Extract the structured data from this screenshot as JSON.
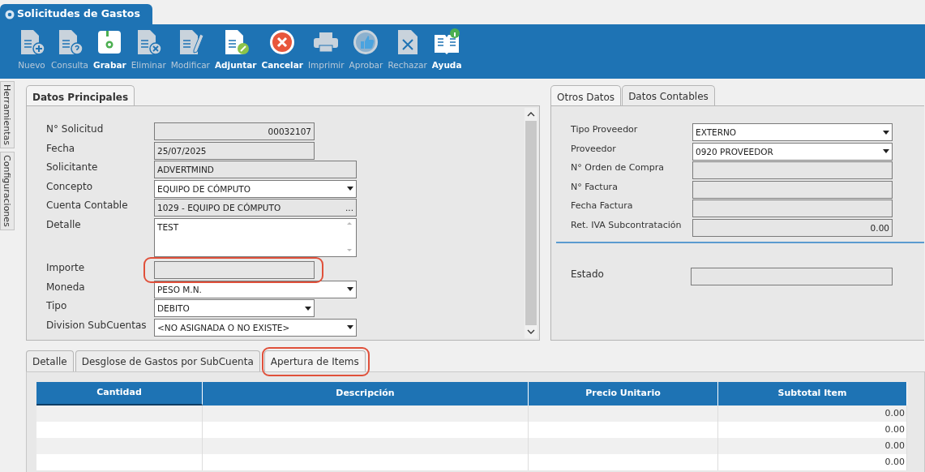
{
  "window": {
    "title": "Solicitudes de Gastos"
  },
  "toolbar": [
    {
      "label": "Nuevo",
      "disabled": true
    },
    {
      "label": "Consulta",
      "disabled": true
    },
    {
      "label": "Grabar",
      "disabled": false
    },
    {
      "label": "Eliminar",
      "disabled": true
    },
    {
      "label": "Modificar",
      "disabled": true
    },
    {
      "label": "Adjuntar",
      "disabled": false
    },
    {
      "label": "Cancelar",
      "disabled": false
    },
    {
      "label": "Imprimir",
      "disabled": true
    },
    {
      "label": "Aprobar",
      "disabled": true
    },
    {
      "label": "Rechazar",
      "disabled": true
    },
    {
      "label": "Ayuda",
      "disabled": false
    }
  ],
  "side_tabs": [
    {
      "label": "Herramientas"
    },
    {
      "label": "Configuraciones"
    }
  ],
  "main_panel": {
    "tabs": [
      {
        "label": "Datos Principales",
        "selected": true
      }
    ],
    "fields": [
      {
        "label": "N° Solicitud",
        "kind": "number",
        "value": "00032107",
        "readonly": true,
        "highlighted": false
      },
      {
        "label": "Fecha",
        "kind": "text",
        "value": "25/07/2025",
        "readonly": true,
        "highlighted": false
      },
      {
        "label": "Solicitante",
        "kind": "text",
        "value": "ADVERTMIND",
        "readonly": true,
        "highlighted": false
      },
      {
        "label": "Concepto",
        "kind": "combo",
        "value": "EQUIPO DE CÓMPUTO",
        "readonly": false,
        "highlighted": false
      },
      {
        "label": "Cuenta Contable",
        "kind": "lookup",
        "value": "1029 - EQUIPO DE CÓMPUTO",
        "button_label": "...",
        "readonly": true,
        "highlighted": false
      },
      {
        "label": "Detalle",
        "kind": "memo",
        "value": "TEST",
        "readonly": false,
        "highlighted": false
      },
      {
        "label": "Importe",
        "kind": "number",
        "readonly": true,
        "highlighted": true
      },
      {
        "label": "Moneda",
        "kind": "combo",
        "value": "PESO M.N.",
        "readonly": false,
        "highlighted": false
      },
      {
        "label": "Tipo",
        "kind": "combo",
        "value": "DEBITO",
        "readonly": false,
        "highlighted": false
      },
      {
        "label": "Division SubCuentas",
        "kind": "combo",
        "value": "<NO ASIGNADA O NO EXISTE>",
        "readonly": false,
        "highlighted": false
      }
    ]
  },
  "side_panel": {
    "tabs": [
      {
        "label": "Otros Datos",
        "selected": true
      },
      {
        "label": "Datos Contables",
        "selected": false
      }
    ],
    "fields": [
      {
        "label": "Tipo Proveedor",
        "kind": "combo",
        "value": "EXTERNO",
        "readonly": false
      },
      {
        "label": "Proveedor",
        "kind": "combo",
        "value": "0920 PROVEEDOR",
        "readonly": false
      },
      {
        "label": "N° Orden de Compra",
        "kind": "text",
        "readonly": true
      },
      {
        "label": "N° Factura",
        "kind": "text",
        "readonly": true
      },
      {
        "label": "Fecha Factura",
        "kind": "text",
        "readonly": true
      },
      {
        "label": "Ret. IVA Subcontratación",
        "kind": "number",
        "value": "0.00",
        "readonly": true
      }
    ],
    "status_field": {
      "label": "Estado",
      "readonly": true
    }
  },
  "detail_tabs": [
    {
      "label": "Detalle",
      "selected": false,
      "highlighted": false
    },
    {
      "label": "Desglose de Gastos por SubCuenta",
      "selected": false,
      "highlighted": false
    },
    {
      "label": "Apertura de Items",
      "selected": true,
      "highlighted": true
    }
  ],
  "items_table": {
    "columns": [
      "Cantidad",
      "Descripción",
      "Precio Unitario",
      "Subtotal Item"
    ],
    "rows": [
      {
        "subtotal": "0.00"
      },
      {
        "subtotal": "0.00"
      },
      {
        "subtotal": "0.00"
      },
      {
        "subtotal": "0.00"
      }
    ]
  }
}
